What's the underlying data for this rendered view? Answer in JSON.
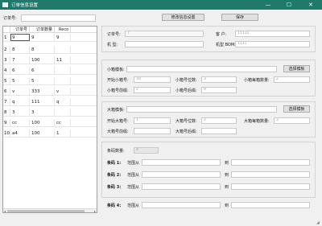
{
  "window": {
    "title": "订单信息设置",
    "minimize": "—",
    "maximize": "☐",
    "close": "✕"
  },
  "order": {
    "label": "订单号:",
    "value": ""
  },
  "buttons": {
    "modify": "修改信息设置",
    "save": "保存"
  },
  "table": {
    "columns": [
      "订单号",
      "订单数量",
      "Reco"
    ],
    "rows": [
      {
        "num": "1",
        "a": "9",
        "b": "9",
        "c": "9"
      },
      {
        "num": "2",
        "a": "8",
        "b": "8",
        "c": ""
      },
      {
        "num": "3",
        "a": "7",
        "b": "100",
        "c": "11"
      },
      {
        "num": "4",
        "a": "6",
        "b": "6",
        "c": ""
      },
      {
        "num": "5",
        "a": "5",
        "b": "5",
        "c": ""
      },
      {
        "num": "6",
        "a": "v",
        "b": "333",
        "c": "v"
      },
      {
        "num": "7",
        "a": "q",
        "b": "111",
        "c": "q"
      },
      {
        "num": "8",
        "a": "3",
        "b": "3",
        "c": ""
      },
      {
        "num": "9",
        "a": "cc",
        "b": "100",
        "c": "cc"
      },
      {
        "num": "10",
        "a": "a4",
        "b": "100",
        "c": "1"
      }
    ]
  },
  "info": {
    "order_no": {
      "label": "订单号:",
      "value": "7"
    },
    "customer": {
      "label": "客    户:",
      "value": "11111"
    },
    "model": {
      "label": "机    型:",
      "value": ""
    },
    "model_bom": {
      "label": "机型 BOM:",
      "value": "1111"
    }
  },
  "small_box": {
    "label": "小箱模板:",
    "path": "",
    "select": "选择模板",
    "start_label": "开始小箱号:",
    "start_value": "10",
    "digits_label": "小箱号位数:",
    "digits_value": "3",
    "per_box_label": "小箱每箱数量:",
    "per_box_value": "2",
    "prefix_label": "小箱号前缀:",
    "prefix_value": "v",
    "suffix_label": "小箱号后缀:",
    "suffix_value": "9"
  },
  "big_box": {
    "label": "大箱模板:",
    "path": "",
    "select": "选择模板",
    "start_label": "开始大箱号:",
    "start_value": "1",
    "digits_label": "大箱号位数:",
    "digits_value": "2",
    "per_box_label": "大箱每箱数量:",
    "per_box_value": "3",
    "prefix_label": "大箱号前缀:",
    "prefix_value": "",
    "suffix_label": "大箱号后缀:",
    "suffix_value": ""
  },
  "barcode": {
    "count_label": "条码数量:",
    "count_value": "4",
    "rows": [
      {
        "label": "条码 1:",
        "range_label": "范围从",
        "to_label": "到"
      },
      {
        "label": "条码 2:",
        "range_label": "范围从",
        "to_label": "到"
      },
      {
        "label": "条码 3:",
        "range_label": "范围从",
        "to_label": "到"
      },
      {
        "label": "条码 4:",
        "range_label": "范围从",
        "to_label": "到"
      }
    ]
  },
  "colors": {
    "titlebar": "#1f7a6d",
    "background": "#f0f0f0"
  }
}
